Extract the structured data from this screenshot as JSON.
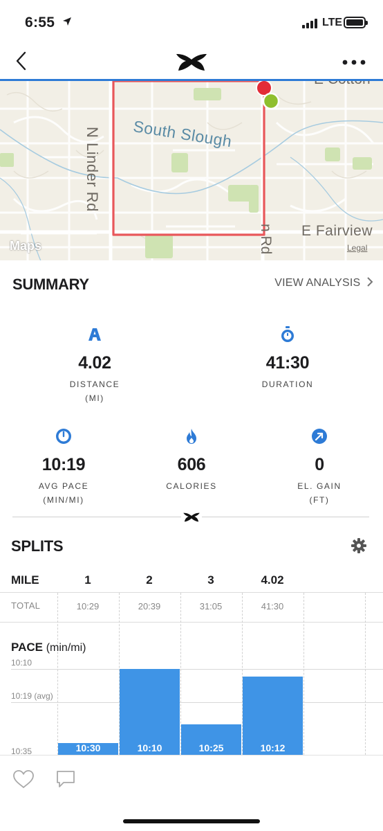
{
  "status_bar": {
    "time": "6:55",
    "network": "LTE"
  },
  "map": {
    "labels": {
      "south_slough": "South Slough",
      "n_linder_rd": "N Linder Rd",
      "e_fairview": "E Fairview",
      "rd": "n Rd",
      "e_cotton": "E Cotton"
    },
    "brand": "Maps",
    "legal": "Legal",
    "route_color": "#e8575a",
    "start_color": "#8fbf2e",
    "end_color": "#e22c36"
  },
  "summary": {
    "title": "SUMMARY",
    "view_analysis": "VIEW ANALYSIS",
    "stats": {
      "distance": {
        "value": "4.02",
        "label": "DISTANCE",
        "unit": "(MI)",
        "icon": "distance-icon"
      },
      "duration": {
        "value": "41:30",
        "label": "DURATION",
        "icon": "stopwatch-icon"
      },
      "avg_pace": {
        "value": "10:19",
        "label": "AVG PACE",
        "unit": "(MIN/MI)",
        "icon": "speedometer-icon"
      },
      "calories": {
        "value": "606",
        "label": "CALORIES",
        "icon": "flame-icon"
      },
      "el_gain": {
        "value": "0",
        "label": "EL. GAIN",
        "unit": "(FT)",
        "icon": "arrow-up-right-icon"
      }
    }
  },
  "splits": {
    "title": "SPLITS",
    "mile_header": "MILE",
    "total_label": "TOTAL",
    "pace_header": "PACE",
    "pace_unit": "(min/mi)",
    "miles": [
      "1",
      "2",
      "3",
      "4.02"
    ],
    "totals": [
      "10:29",
      "20:39",
      "31:05",
      "41:30"
    ],
    "axis": {
      "top": "10:10",
      "avg": "10:19 (avg)",
      "bottom": "10:35"
    }
  },
  "chart_data": {
    "type": "bar",
    "categories": [
      "1",
      "2",
      "3",
      "4.02"
    ],
    "values": [
      "10:30",
      "10:10",
      "10:25",
      "10:12"
    ],
    "values_seconds": [
      630,
      610,
      625,
      612
    ],
    "ylabel": "PACE (min/mi)",
    "ylim_seconds": [
      635,
      610
    ],
    "y_ticks": [
      "10:10",
      "10:19 (avg)",
      "10:35"
    ],
    "avg_seconds": 619,
    "bar_color": "#3f94e6",
    "inverted_axis": true
  },
  "accent_color": "#2e7bd6"
}
